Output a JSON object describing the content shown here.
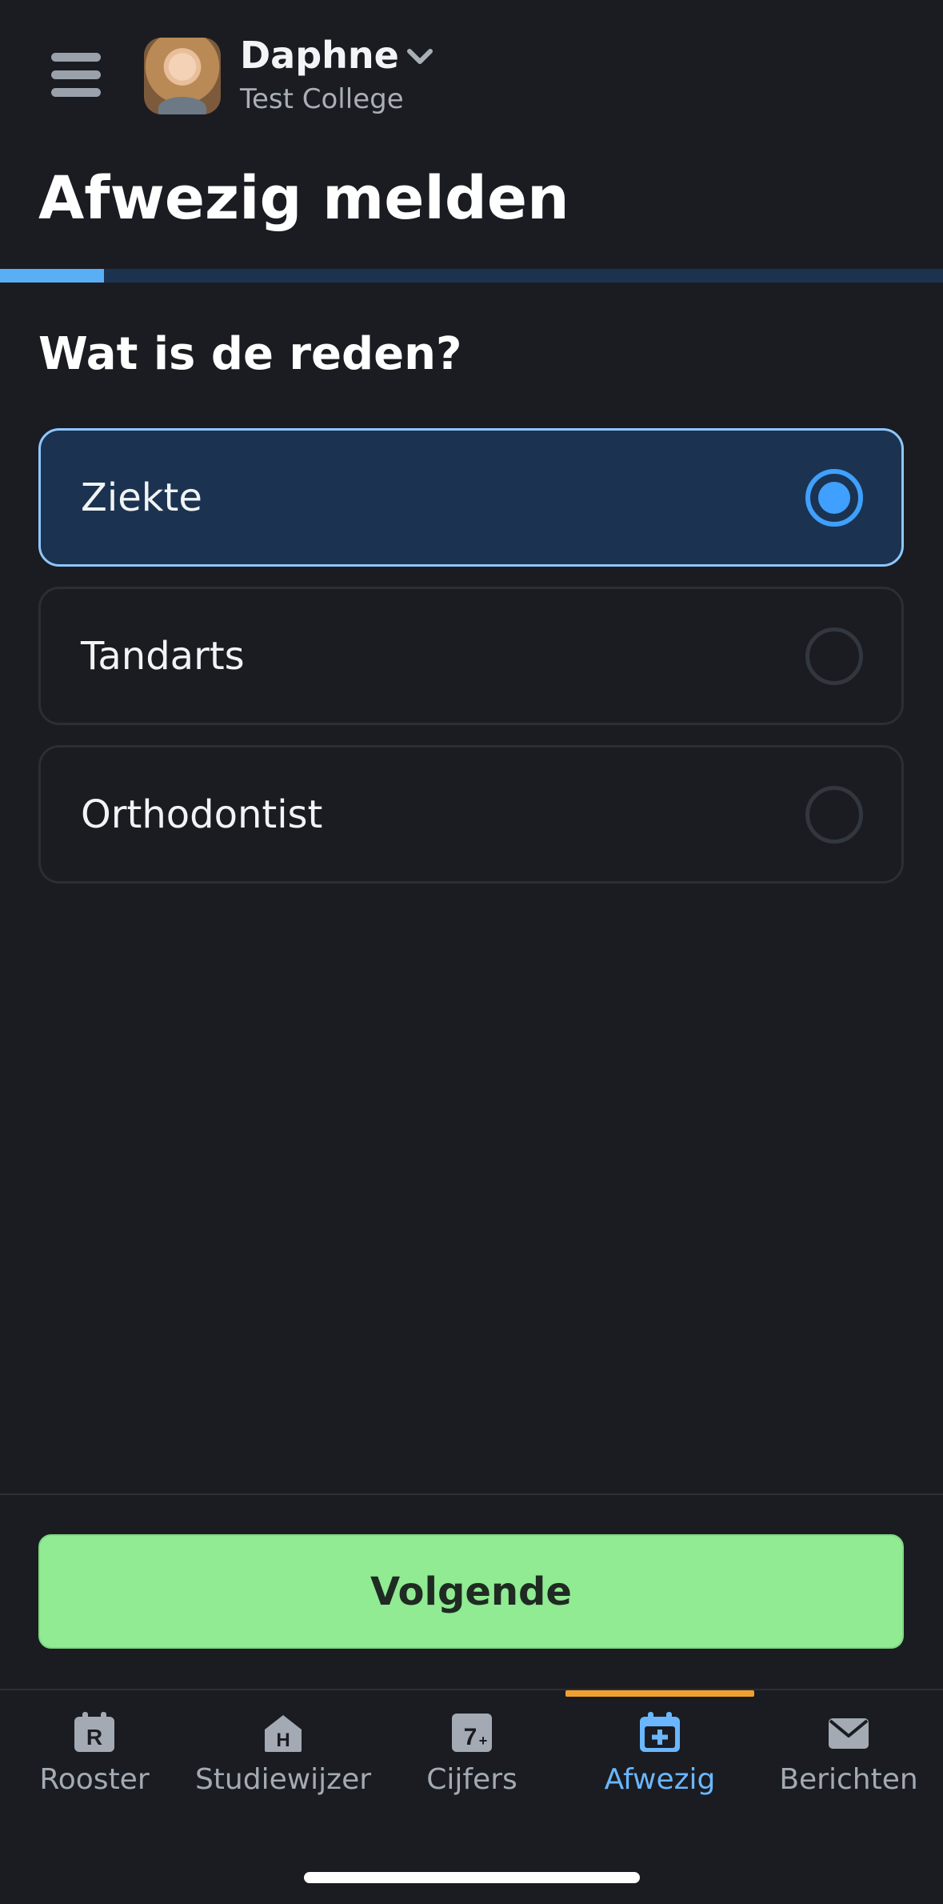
{
  "header": {
    "user_name": "Daphne",
    "school": "Test College"
  },
  "page": {
    "title": "Afwezig melden",
    "question": "Wat is de reden?",
    "progress": 0.11
  },
  "options": [
    {
      "label": "Ziekte",
      "selected": true
    },
    {
      "label": "Tandarts",
      "selected": false
    },
    {
      "label": "Orthodontist",
      "selected": false
    }
  ],
  "actions": {
    "next_label": "Volgende"
  },
  "tabs": [
    {
      "label": "Rooster",
      "icon": "rooster-icon",
      "glyph": "R"
    },
    {
      "label": "Studiewijzer",
      "icon": "studiewijzer-icon",
      "glyph": "H"
    },
    {
      "label": "Cijfers",
      "icon": "cijfers-icon",
      "glyph": "7+"
    },
    {
      "label": "Afwezig",
      "icon": "afwezig-icon",
      "active": true
    },
    {
      "label": "Berichten",
      "icon": "berichten-icon"
    }
  ],
  "colors": {
    "background": "#1a1c21",
    "accent": "#3fa0ff",
    "next_button": "#90eb92",
    "tab_indicator": "#f0a030"
  }
}
